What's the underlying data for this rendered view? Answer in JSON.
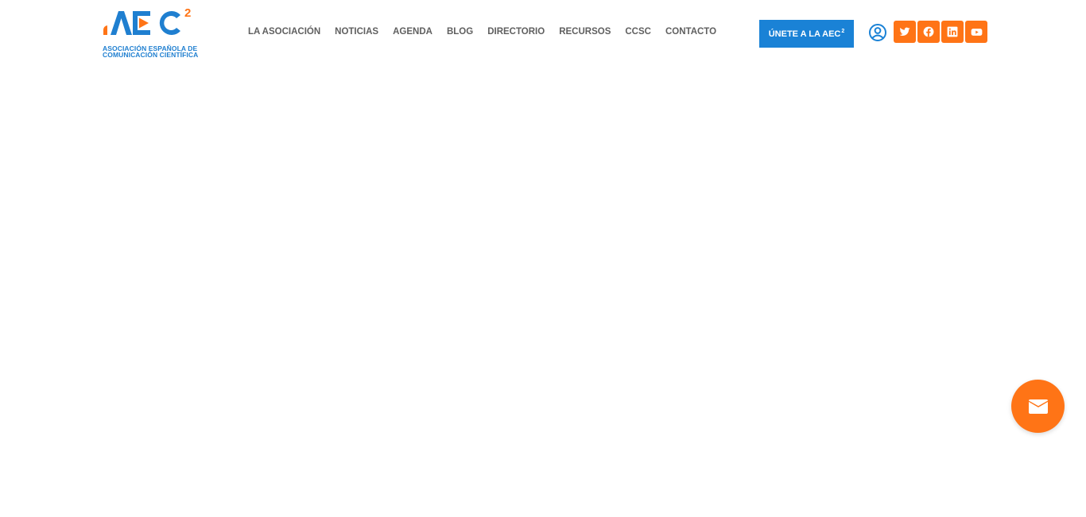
{
  "brand": {
    "logo_text": "AEC2",
    "tagline_line1": "ASOCIACIÓN ESPAÑOLA DE",
    "tagline_line2": "COMUNICACIÓN CIENTÍFICA",
    "blue": "#1f7fd0",
    "orange": "#ff7416"
  },
  "nav": {
    "items": [
      {
        "label": "LA ASOCIACIÓN"
      },
      {
        "label": "NOTICIAS"
      },
      {
        "label": "AGENDA"
      },
      {
        "label": "BLOG"
      },
      {
        "label": "DIRECTORIO"
      },
      {
        "label": "RECURSOS"
      },
      {
        "label": "CCSC"
      },
      {
        "label": "CONTACTO"
      }
    ]
  },
  "header": {
    "join_label": "ÚNETE A LA AEC",
    "join_sup": "2",
    "join_color": "#1a82d6",
    "user_icon": "user-circle-icon",
    "social": [
      {
        "icon": "twitter-icon"
      },
      {
        "icon": "facebook-icon"
      },
      {
        "icon": "linkedin-icon"
      },
      {
        "icon": "youtube-icon"
      }
    ]
  },
  "floating": {
    "icon": "envelope-icon",
    "color": "#ff7416"
  }
}
